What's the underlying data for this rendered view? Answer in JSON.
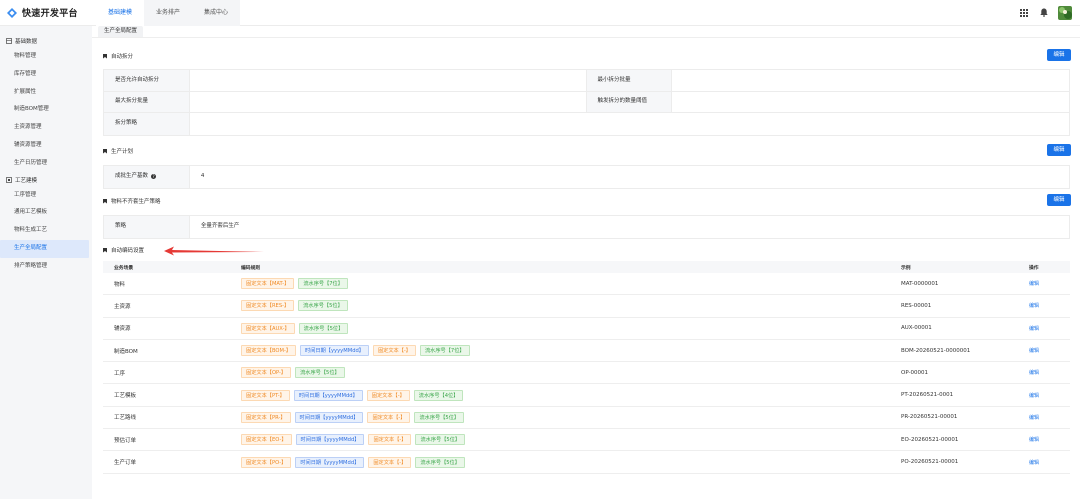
{
  "app": {
    "title": "快速开发平台"
  },
  "topnav": [
    {
      "label": "基础建模",
      "active": true
    },
    {
      "label": "业务排产",
      "active": false
    },
    {
      "label": "集成中心",
      "active": false
    }
  ],
  "topright": {
    "apps_icon": "grid-icon",
    "bell_icon": "bell-icon",
    "avatar_icon": "avatar-image"
  },
  "sidebar": {
    "groups": [
      {
        "label": "基础数据",
        "icon": "database-icon",
        "items": [
          {
            "label": "物料管理"
          },
          {
            "label": "库存管理"
          },
          {
            "label": "扩展属性"
          },
          {
            "label": "制造BOM管理"
          },
          {
            "label": "主资源管理"
          },
          {
            "label": "辅资源管理"
          },
          {
            "label": "生产日历管理"
          }
        ]
      },
      {
        "label": "工艺建模",
        "icon": "process-icon",
        "items": [
          {
            "label": "工序管理"
          },
          {
            "label": "通用工艺模板"
          },
          {
            "label": "物料生成工艺"
          },
          {
            "label": "生产全局配置",
            "active": true
          },
          {
            "label": "排产策略管理"
          }
        ]
      }
    ]
  },
  "tab": {
    "label": "生产全局配置"
  },
  "sections": {
    "auto_split": {
      "title": "自动拆分",
      "edit_label": "编辑",
      "rows": [
        {
          "k1": "是否允许自动拆分",
          "v1": "",
          "k2": "最小拆分批量",
          "v2": ""
        },
        {
          "k1": "最大拆分批量",
          "v1": "",
          "k2": "触发拆分的数量阈值",
          "v2": ""
        },
        {
          "k1": "拆分策略",
          "v1": ""
        }
      ]
    },
    "production_plan": {
      "title": "生产计划",
      "edit_label": "编辑",
      "rows": [
        {
          "k1": "成批生产基数",
          "v1": "4"
        }
      ]
    },
    "material_shortage": {
      "title": "物料不齐套生产策略",
      "edit_label": "编辑",
      "rows": [
        {
          "k1": "策略",
          "v1": "全量齐套后生产"
        }
      ]
    },
    "auto_code": {
      "title": "自动编码设置",
      "headers": [
        "业务场景",
        "编码规则",
        "示例",
        "操作"
      ],
      "rows": [
        {
          "scene": "物料",
          "rules": [
            {
              "t": "fixed",
              "text": "固定文本【MAT-】"
            },
            {
              "t": "serial",
              "text": "流水序号【7位】"
            }
          ],
          "example": "MAT-0000001",
          "op": "编辑"
        },
        {
          "scene": "主资源",
          "rules": [
            {
              "t": "fixed",
              "text": "固定文本【RES-】"
            },
            {
              "t": "serial",
              "text": "流水序号【5位】"
            }
          ],
          "example": "RES-00001",
          "op": "编辑"
        },
        {
          "scene": "辅资源",
          "rules": [
            {
              "t": "fixed",
              "text": "固定文本【AUX-】"
            },
            {
              "t": "serial",
              "text": "流水序号【5位】"
            }
          ],
          "example": "AUX-00001",
          "op": "编辑"
        },
        {
          "scene": "制造BOM",
          "rules": [
            {
              "t": "fixed",
              "text": "固定文本【BOM-】"
            },
            {
              "t": "date",
              "text": "时间日期【yyyyMMdd】"
            },
            {
              "t": "fixed",
              "text": "固定文本【-】"
            },
            {
              "t": "serial",
              "text": "流水序号【7位】"
            }
          ],
          "example": "BOM-20260521-0000001",
          "op": "编辑"
        },
        {
          "scene": "工序",
          "rules": [
            {
              "t": "fixed",
              "text": "固定文本【OP-】"
            },
            {
              "t": "serial",
              "text": "流水序号【5位】"
            }
          ],
          "example": "OP-00001",
          "op": "编辑"
        },
        {
          "scene": "工艺模板",
          "rules": [
            {
              "t": "fixed",
              "text": "固定文本【PT-】"
            },
            {
              "t": "date",
              "text": "时间日期【yyyyMMdd】"
            },
            {
              "t": "fixed",
              "text": "固定文本【-】"
            },
            {
              "t": "serial",
              "text": "流水序号【4位】"
            }
          ],
          "example": "PT-20260521-0001",
          "op": "编辑"
        },
        {
          "scene": "工艺路线",
          "rules": [
            {
              "t": "fixed",
              "text": "固定文本【PR-】"
            },
            {
              "t": "date",
              "text": "时间日期【yyyyMMdd】"
            },
            {
              "t": "fixed",
              "text": "固定文本【-】"
            },
            {
              "t": "serial",
              "text": "流水序号【5位】"
            }
          ],
          "example": "PR-20260521-00001",
          "op": "编辑"
        },
        {
          "scene": "预估订单",
          "rules": [
            {
              "t": "fixed",
              "text": "固定文本【EO-】"
            },
            {
              "t": "date",
              "text": "时间日期【yyyyMMdd】"
            },
            {
              "t": "fixed",
              "text": "固定文本【-】"
            },
            {
              "t": "serial",
              "text": "流水序号【5位】"
            }
          ],
          "example": "EO-20260521-00001",
          "op": "编辑"
        },
        {
          "scene": "生产订单",
          "rules": [
            {
              "t": "fixed",
              "text": "固定文本【PO-】"
            },
            {
              "t": "date",
              "text": "时间日期【yyyyMMdd】"
            },
            {
              "t": "fixed",
              "text": "固定文本【-】"
            },
            {
              "t": "serial",
              "text": "流水序号【5位】"
            }
          ],
          "example": "PO-20260521-00001",
          "op": "编辑"
        }
      ]
    }
  },
  "colors": {
    "accent": "#1a73e8",
    "fixed_chip": "#f08a24",
    "serial_chip": "#3aa64a",
    "date_chip": "#2f6fe0",
    "arrow": "#e53935"
  }
}
